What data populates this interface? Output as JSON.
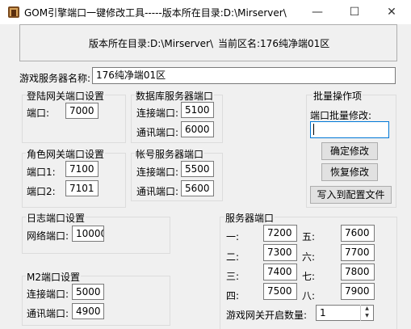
{
  "window": {
    "title": "GOM引擎端口一键修改工具-----版本所在目录:D:\\Mirserver\\",
    "minimize_glyph": "—",
    "maximize_glyph": "☐",
    "close_glyph": "✕"
  },
  "info": {
    "version_dir": "版本所在目录:D:\\Mirserver\\",
    "current_zone": "当前区名:176纯净端01区"
  },
  "server_name": {
    "label": "游戏服务器名称:",
    "value": "176纯净端01区"
  },
  "login_gate": {
    "title": "登陆网关端口设置",
    "port_label": "端口:",
    "port_value": "7000"
  },
  "db_server": {
    "title": "数据库服务器端口",
    "connect_label": "连接端口:",
    "connect_value": "5100",
    "comm_label": "通讯端口:",
    "comm_value": "6000"
  },
  "batch": {
    "title": "批量操作项",
    "label": "端口批量修改:",
    "input_value": "",
    "confirm": "确定修改",
    "restore": "恢复修改",
    "write_config": "写入到配置文件"
  },
  "role_gate": {
    "title": "角色网关端口设置",
    "port1_label": "端口1:",
    "port1_value": "7100",
    "port2_label": "端口2:",
    "port2_value": "7101"
  },
  "account_server": {
    "title": "帐号服务器端口",
    "connect_label": "连接端口:",
    "connect_value": "5500",
    "comm_label": "通讯端口:",
    "comm_value": "5600"
  },
  "log_port": {
    "title": "日志端口设置",
    "net_label": "网络端口:",
    "net_value": "10000"
  },
  "m2_port": {
    "title": "M2端口设置",
    "connect_label": "连接端口:",
    "connect_value": "5000",
    "comm_label": "通讯端口:",
    "comm_value": "4900"
  },
  "server_ports": {
    "title": "服务器端口",
    "rows": [
      {
        "l1": "一:",
        "v1": "7200",
        "l2": "五:",
        "v2": "7600"
      },
      {
        "l1": "二:",
        "v1": "7300",
        "l2": "六:",
        "v2": "7700"
      },
      {
        "l1": "三:",
        "v1": "7400",
        "l2": "七:",
        "v2": "7800"
      },
      {
        "l1": "四:",
        "v1": "7500",
        "l2": "八:",
        "v2": "7900"
      }
    ],
    "gate_count_label": "游戏网关开启数量:",
    "gate_count_value": "1"
  }
}
